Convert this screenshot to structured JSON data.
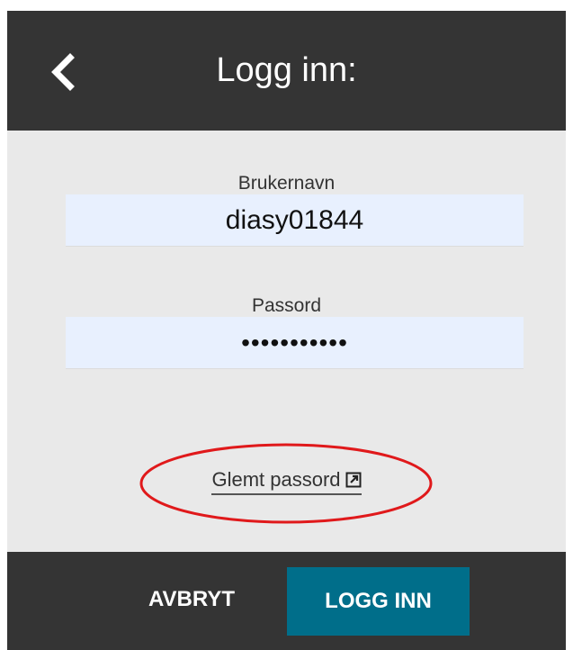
{
  "header": {
    "title": "Logg inn:",
    "back_icon": "chevron-left-icon"
  },
  "form": {
    "username_label": "Brukernavn",
    "username_value": "diasy01844",
    "password_label": "Passord",
    "password_value": "•••••••••••"
  },
  "forgot_password": {
    "label": "Glemt passord",
    "icon": "external-link-icon"
  },
  "annotation": {
    "shape": "ellipse",
    "color": "#e0191b"
  },
  "footer": {
    "cancel_label": "AVBRYT",
    "login_label": "LOGG INN"
  },
  "colors": {
    "header_bg": "#343434",
    "body_bg": "#e9e9e9",
    "input_bg": "#e8f0fe",
    "primary_button": "#006e8a"
  }
}
